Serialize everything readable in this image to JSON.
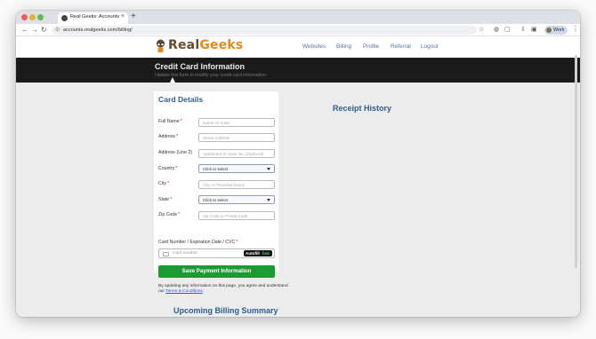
{
  "browser": {
    "tab_title": "Real Geeks: Accounts",
    "url": "accounts.realgeeks.com/billing/",
    "profile_label": "Work"
  },
  "site": {
    "logo_part1": "Real",
    "logo_part2": "Geeks",
    "nav": [
      "Websites",
      "Billing",
      "Profile",
      "Referral",
      "Logout"
    ]
  },
  "banner": {
    "title": "Credit Card Information",
    "subtitle": "Update this form to modify your credit card information."
  },
  "card_details": {
    "title": "Card Details",
    "fields": [
      {
        "label": "Full Name",
        "required": "*",
        "placeholder": "Name on Card"
      },
      {
        "label": "Address",
        "required": "*",
        "placeholder": "Street Address"
      },
      {
        "label": "Address (Line 2)",
        "required": "",
        "placeholder": "Apartment or Suite No. (Optional)"
      },
      {
        "label": "Country",
        "required": "*",
        "select_value": "Click to select"
      },
      {
        "label": "City",
        "required": "*",
        "placeholder": "City or Township Name"
      },
      {
        "label": "State",
        "required": "*",
        "select_value": "Click to select"
      },
      {
        "label": "Zip Code",
        "required": "*",
        "placeholder": "Zip Code or Postal Code"
      }
    ],
    "card_number_label": "Card Number / Expiration Date / CVC",
    "card_number_required": "*",
    "card_number_placeholder": "Card number",
    "autofill_part1": "Autofill",
    "autofill_part2": "link",
    "save_label": "Save Payment Information",
    "disclaimer_text": "By updating any information on this page, you agree and understand our ",
    "terms_link": "Terms & Conditions",
    "disclaimer_end": "."
  },
  "receipt_history_title": "Receipt History",
  "upcoming_billing_title": "Upcoming Billing Summary",
  "colors": {
    "accent_blue": "#2c5d8e",
    "save_green": "#1c9b33",
    "banner_dark": "#1a1a1a"
  }
}
